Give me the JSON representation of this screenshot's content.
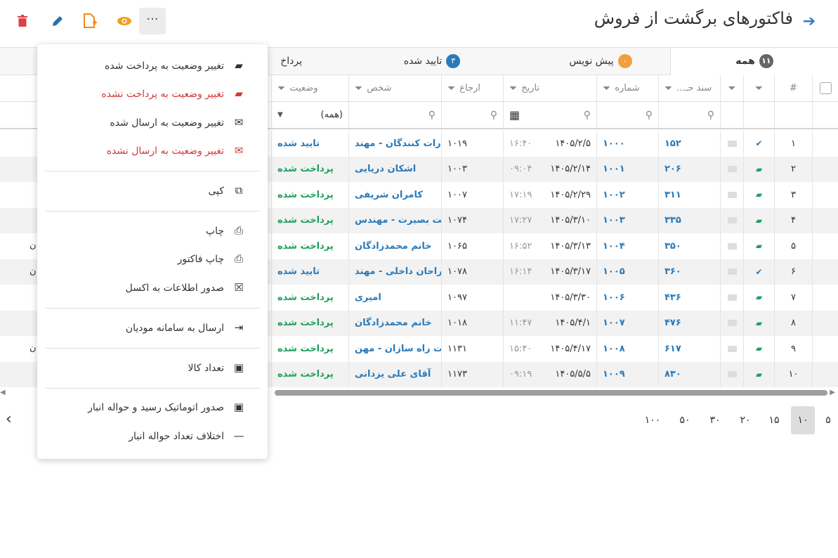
{
  "header": {
    "title": "فاکتورهای برگشت از فروش",
    "back_icon": "arrow-right-icon"
  },
  "toolbar": {
    "more_label": "···"
  },
  "tabs": [
    {
      "label": "همه",
      "count": "۱۱",
      "color": "#666666"
    },
    {
      "label": "پیش نویس",
      "count": "۰",
      "color": "#f0a040"
    },
    {
      "label": "تایید شده",
      "count": "۳",
      "color": "#2a7ab9"
    },
    {
      "label": "پرداخ"
    }
  ],
  "columns": {
    "index": "#",
    "doc": "سند حـ...",
    "number": "شماره",
    "date": "تاریخ",
    "ref": "ارجاع",
    "person": "شخص",
    "status": "وضعیت"
  },
  "filter": {
    "status_value": "(همه)"
  },
  "rows": [
    {
      "i": "۱",
      "doc": "۱۵۲",
      "num": "۱۰۰۰",
      "date": "۱۴۰۵/۲/۵",
      "time": "۱۶:۴۰",
      "ref": "۱۰۱۹",
      "person": "صادرات کنندگان - مهند",
      "status": "تایید شده",
      "st": "blue",
      "icon": "✔"
    },
    {
      "i": "۲",
      "doc": "۲۰۶",
      "num": "۱۰۰۱",
      "date": "۱۴۰۵/۲/۱۴",
      "time": "۰۹:۰۴",
      "ref": "۱۰۰۳",
      "person": "اشکان دریایی",
      "status": "پرداخت شده",
      "st": "green",
      "icon": "▰"
    },
    {
      "i": "۳",
      "doc": "۳۱۱",
      "num": "۱۰۰۲",
      "date": "۱۴۰۵/۲/۲۹",
      "time": "۱۷:۱۹",
      "ref": "۱۰۰۷",
      "person": "کامران شریفی",
      "status": "پرداخت شده",
      "st": "green",
      "icon": "▰"
    },
    {
      "i": "۴",
      "doc": "۳۳۵",
      "num": "۱۰۰۳",
      "date": "۱۴۰۵/۳/۱۰",
      "time": "۱۷:۲۷",
      "ref": "۱۰۷۴",
      "person": "شرکت بصیرت - مهندس",
      "status": "پرداخت شده",
      "st": "green",
      "icon": "▰"
    },
    {
      "i": "۵",
      "doc": "۳۵۰",
      "num": "۱۰۰۴",
      "date": "۱۴۰۵/۳/۱۳",
      "time": "۱۶:۵۲",
      "ref": "۱۰۶۵",
      "person": "خانم محمدزادگان",
      "status": "پرداخت شده",
      "st": "green",
      "icon": "▰"
    },
    {
      "i": "۶",
      "doc": "۳۶۰",
      "num": "۱۰۰۵",
      "date": "۱۴۰۵/۳/۱۷",
      "time": "۱۶:۱۴",
      "ref": "۱۰۷۸",
      "person": "طراحان داخلی - مهند",
      "status": "تایید شده",
      "st": "blue",
      "icon": "✔"
    },
    {
      "i": "۷",
      "doc": "۴۳۶",
      "num": "۱۰۰۶",
      "date": "۱۴۰۵/۳/۳۰",
      "time": "",
      "ref": "۱۰۹۷",
      "person": "امیری",
      "status": "پرداخت شده",
      "st": "green",
      "icon": "▰"
    },
    {
      "i": "۸",
      "doc": "۴۷۶",
      "num": "۱۰۰۷",
      "date": "۱۴۰۵/۴/۱",
      "time": "۱۱:۴۷",
      "ref": "۱۰۱۸",
      "person": "خانم محمدزادگان",
      "status": "پرداخت شده",
      "st": "green",
      "icon": "▰"
    },
    {
      "i": "۹",
      "doc": "۶۱۷",
      "num": "۱۰۰۸",
      "date": "۱۴۰۵/۴/۱۷",
      "time": "۱۵:۴۰",
      "ref": "۱۱۳۱",
      "person": "شرکت راه سازان - مهن",
      "status": "پرداخت شده",
      "st": "green",
      "icon": "▰"
    },
    {
      "i": "۱۰",
      "doc": "۸۳۰",
      "num": "۱۰۰۹",
      "date": "۱۴۰۵/۵/۵",
      "time": "۰۹:۱۹",
      "ref": "۱۱۷۳",
      "person": "آقای علی یزدانی",
      "status": "پرداخت شده",
      "st": "green",
      "icon": "▰"
    }
  ],
  "left_partial": [
    "ن",
    "ن",
    "ن"
  ],
  "pager": {
    "sizes": [
      "۵",
      "۱۰",
      "۱۵",
      "۲۰",
      "۳۰",
      "۵۰",
      "۱۰۰"
    ],
    "active": "۱۰",
    "next_icon": "chevron-left-icon"
  },
  "menu": {
    "items": [
      {
        "label": "تغییر وضعیت به پرداخت شده",
        "icon": "payment-icon",
        "glyph": "▰",
        "red": false
      },
      {
        "label": "تغییر وضعیت به پرداخت نشده",
        "icon": "payment-off-icon",
        "glyph": "▰",
        "red": true
      },
      {
        "label": "تغییر وضعیت به ارسال شده",
        "icon": "envelope-icon",
        "glyph": "✉",
        "red": false
      },
      {
        "label": "تغییر وضعیت به ارسال نشده",
        "icon": "envelope-off-icon",
        "glyph": "✉",
        "red": true
      },
      {
        "label": "کپی",
        "icon": "copy-icon",
        "glyph": "⧉",
        "red": false
      },
      {
        "label": "چاپ",
        "icon": "print-icon",
        "glyph": "⎙",
        "red": false
      },
      {
        "label": "چاپ فاکتور",
        "icon": "print-invoice-icon",
        "glyph": "⎙",
        "red": false
      },
      {
        "label": "صدور اطلاعات به اکسل",
        "icon": "excel-icon",
        "glyph": "☒",
        "red": false
      },
      {
        "label": "ارسال به سامانه مودیان",
        "icon": "send-login-icon",
        "glyph": "⇥",
        "red": false
      },
      {
        "label": "تعداد کالا",
        "icon": "briefcase-icon",
        "glyph": "▣",
        "red": false
      },
      {
        "label": "صدور اتوماتیک رسید و حواله انبار",
        "icon": "briefcase-icon",
        "glyph": "▣",
        "red": false
      },
      {
        "label": "اختلاف تعداد حواله انبار",
        "icon": "minus-icon",
        "glyph": "—",
        "red": false
      }
    ]
  },
  "colors": {
    "accent": "#2a7ab9",
    "green": "#20a05f",
    "red": "#d23a3a",
    "orange": "#f0a040"
  }
}
